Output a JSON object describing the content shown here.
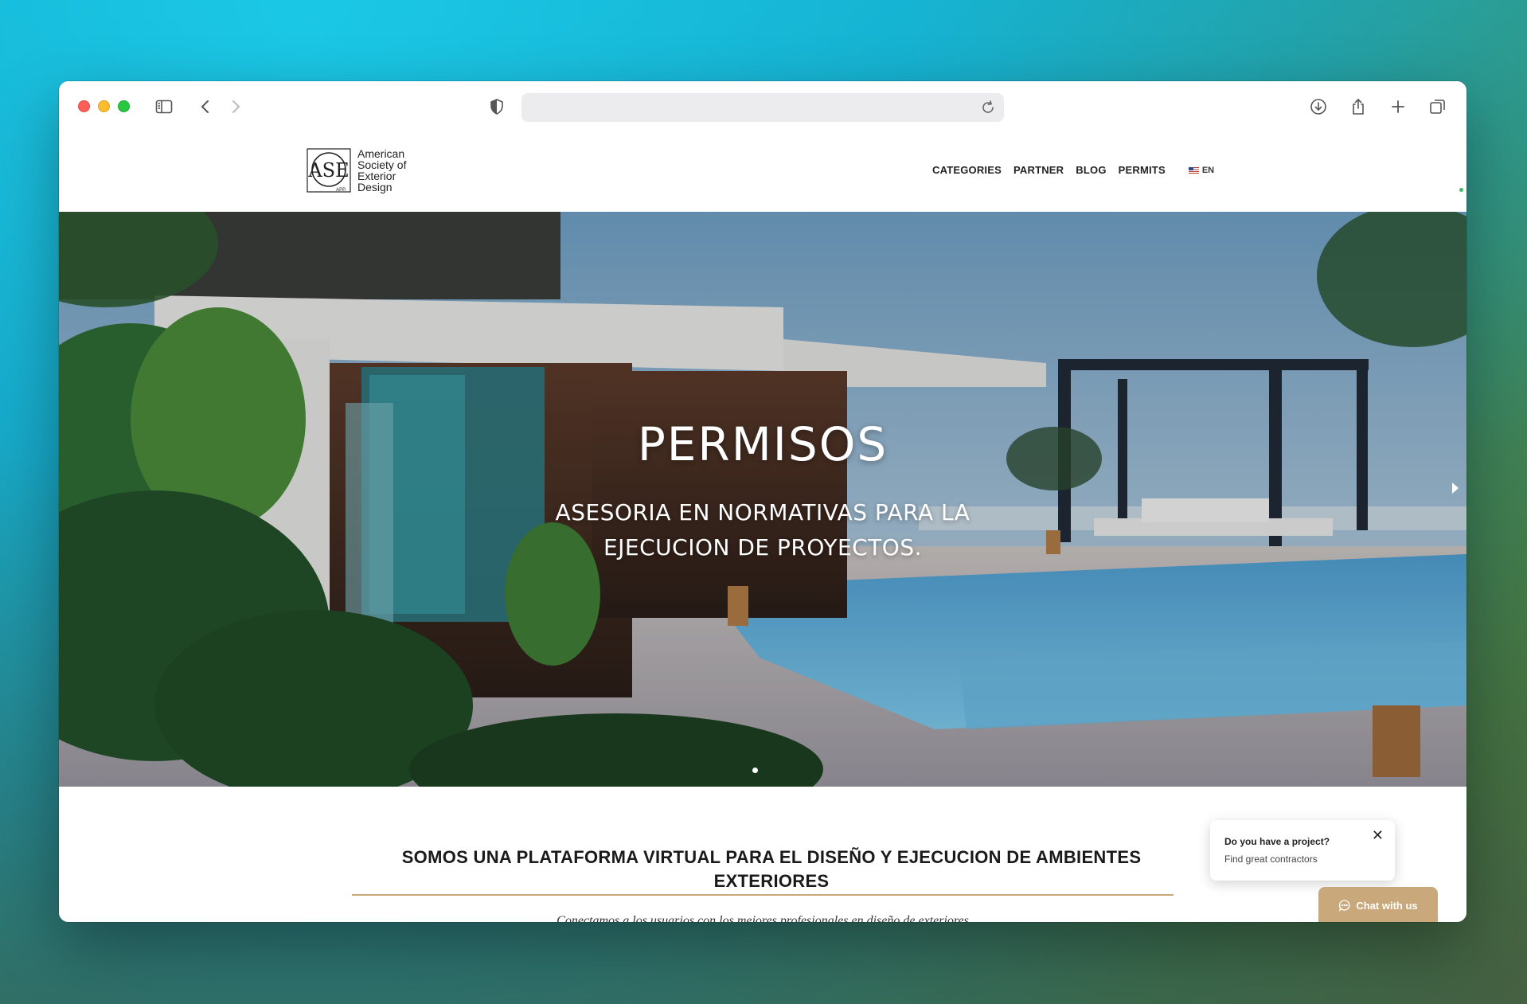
{
  "site": {
    "logo_lines": [
      "American",
      "Society of",
      "Exterior",
      "Design"
    ],
    "logo_monogram": "ASE",
    "logo_tag": "APP."
  },
  "nav": {
    "items": [
      {
        "label": "CATEGORIES"
      },
      {
        "label": "PARTNER"
      },
      {
        "label": "BLOG"
      },
      {
        "label": "PERMITS"
      }
    ],
    "lang": "EN"
  },
  "hero": {
    "title": "PERMISOS",
    "subtitle_line1": "ASESORIA EN NORMATIVAS PARA LA",
    "subtitle_line2": "EJECUCION DE PROYECTOS."
  },
  "section": {
    "title_line1": "SOMOS UNA PLATAFORMA VIRTUAL PARA EL DISEÑO Y EJECUCION DE AMBIENTES",
    "title_line2": "EXTERIORES",
    "subtitle": "Conectamos a los usuarios con los mejores profesionales en diseño de exteriores"
  },
  "chat": {
    "question": "Do you have a project?",
    "answer": "Find great contractors",
    "close": "✕",
    "button": "Chat with us"
  },
  "colors": {
    "accent": "#c9a97c",
    "text": "#1a1a1a"
  }
}
